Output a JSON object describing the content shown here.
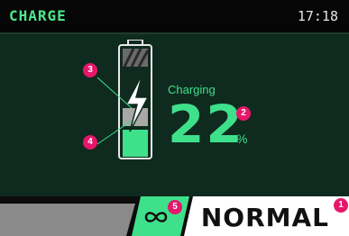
{
  "header": {
    "title": "CHARGE",
    "time": "17:18"
  },
  "battery": {
    "status_label": "Charging",
    "percent": "22",
    "percent_unit": "%",
    "level": 0.22
  },
  "mode": {
    "label": "NORMAL"
  },
  "annotations": [
    "1",
    "2",
    "3",
    "4",
    "5"
  ],
  "icons": {
    "battery": "battery-icon",
    "bolt": "lightning-bolt-icon",
    "mode": "infinity-link-icon"
  },
  "colors": {
    "accent": "#3ee08a",
    "background": "#0f2a1f",
    "badge": "#e6176b",
    "mode_bar": "#ffffff",
    "left_bar": "#8a8a8a"
  }
}
